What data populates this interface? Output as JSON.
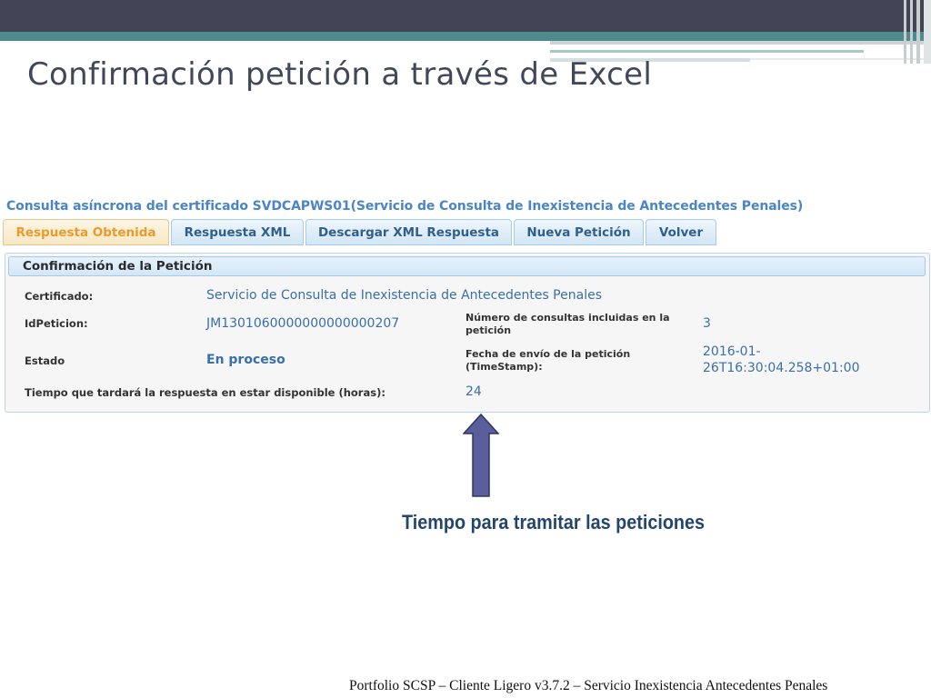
{
  "slide": {
    "title": "Confirmación petición a través de Excel",
    "footer": "Portfolio SCSP – Cliente Ligero v3.7.2 – Servicio  Inexistencia Antecedentes Penales"
  },
  "app": {
    "title": "Consulta asíncrona del certificado SVDCAPWS01(Servicio de Consulta de Inexistencia de Antecedentes Penales)",
    "tabs": [
      {
        "label": "Respuesta Obtenida",
        "active": true
      },
      {
        "label": "Respuesta XML",
        "active": false
      },
      {
        "label": "Descargar XML Respuesta",
        "active": false
      },
      {
        "label": "Nueva Petición",
        "active": false
      },
      {
        "label": "Volver",
        "active": false
      }
    ],
    "panel": {
      "header": "Confirmación de la Petición",
      "certificado_label": "Certificado:",
      "certificado_value": "Servicio de Consulta de Inexistencia de Antecedentes Penales",
      "idpeticion_label": "IdPeticion:",
      "idpeticion_value": "JM1301060000000000000207",
      "num_consultas_label": "Número de consultas incluidas en la petición",
      "num_consultas_value": "3",
      "estado_label": "Estado",
      "estado_value": "En proceso",
      "fecha_label": "Fecha de envío de la petición (TimeStamp):",
      "fecha_value_line1": "2016-01-",
      "fecha_value_line2": "26T16:30:04.258+01:00",
      "tiempo_label": "Tiempo que tardará la respuesta en estar disponible (horas):",
      "tiempo_value": "24"
    }
  },
  "annotation": {
    "caption": "Tiempo para tramitar las peticiones",
    "arrow_direction": "up",
    "arrow_color": "#5a5f9c"
  },
  "colors": {
    "tab_active_text": "#ec9a2a",
    "value_text": "#3a6fa8",
    "app_title": "#4a86c7"
  }
}
